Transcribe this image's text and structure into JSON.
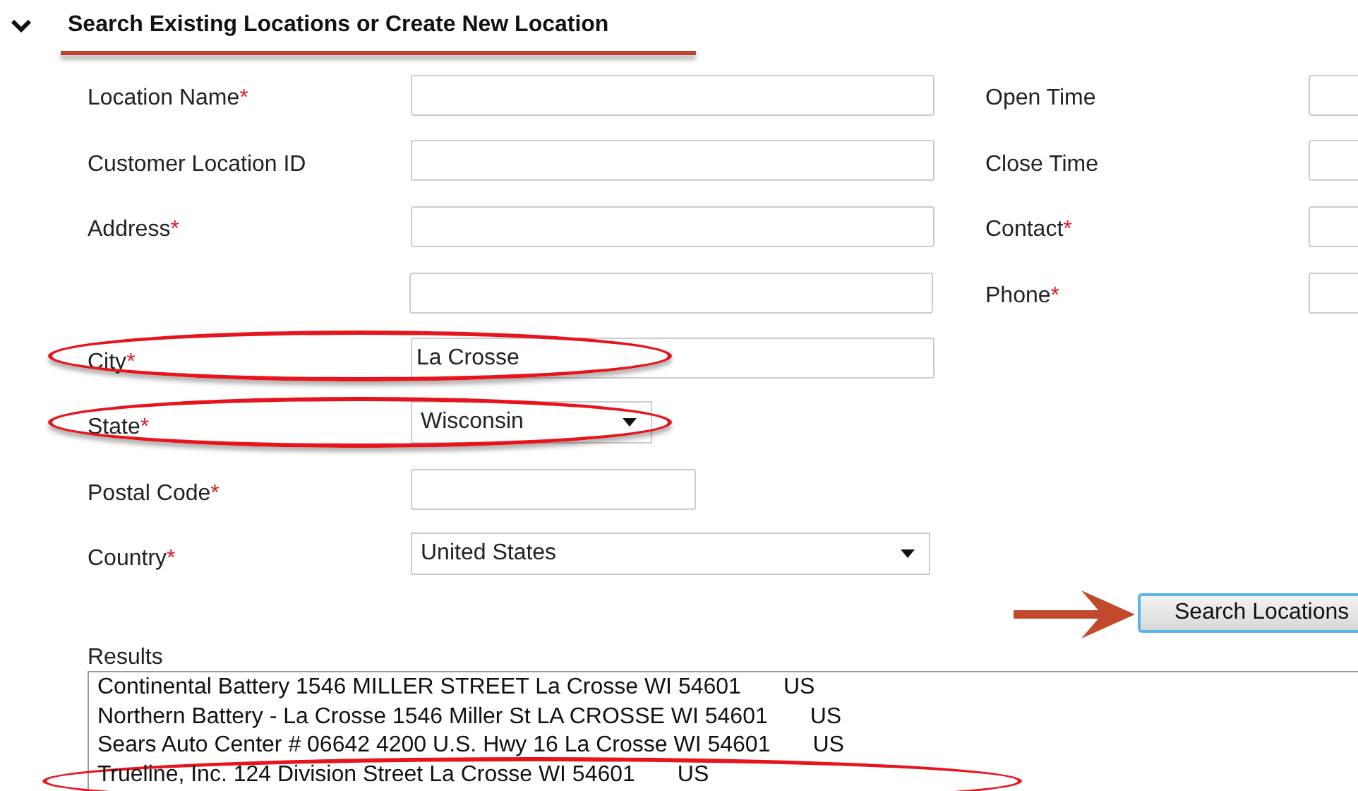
{
  "section": {
    "title": "Search Existing Locations or Create New Location",
    "expanded": true,
    "underlined": true
  },
  "fields": [
    {
      "label": "Location Name",
      "mark": "*",
      "kind": "text",
      "circled": false
    },
    {
      "label": "Customer Location ID",
      "kind": "text",
      "circled": false
    },
    {
      "label": "Address",
      "mark": "*",
      "kind": "text",
      "circled": false
    },
    {
      "kind": "text",
      "circled": false
    },
    {
      "label": "City",
      "mark": "*",
      "kind": "text",
      "value": "La Crosse",
      "circled": true
    },
    {
      "label": "State",
      "mark": "*",
      "kind": "select",
      "value": "Wisconsin",
      "circled": true
    },
    {
      "label": "Postal Code",
      "mark": "*",
      "kind": "short",
      "circled": false
    },
    {
      "label": "Country",
      "mark": "*",
      "kind": "select",
      "value": "United States",
      "circled": false
    }
  ],
  "side_fields": [
    {
      "label": "Open Time"
    },
    {
      "label": "Close Time"
    },
    {
      "label": "Contact",
      "mark": "*"
    },
    {
      "label": "Phone",
      "mark": "*"
    }
  ],
  "search_button": {
    "label": "Search Locations",
    "pointed_at": true
  },
  "results": {
    "label": "Results",
    "items": [
      {
        "text": "Continental Battery 1546 MILLER STREET La Crosse WI 54601",
        "country": "US",
        "circled": false
      },
      {
        "text": "Northern Battery - La Crosse 1546 Miller St LA CROSSE WI 54601",
        "country": "US",
        "circled": false
      },
      {
        "text": "Sears Auto Center # 06642 4200 U.S. Hwy 16 La Crosse WI 54601",
        "country": "US",
        "circled": false
      },
      {
        "text": "Trueline, Inc. 124 Division Street La Crosse WI 54601",
        "country": "US",
        "circled": true
      }
    ]
  }
}
